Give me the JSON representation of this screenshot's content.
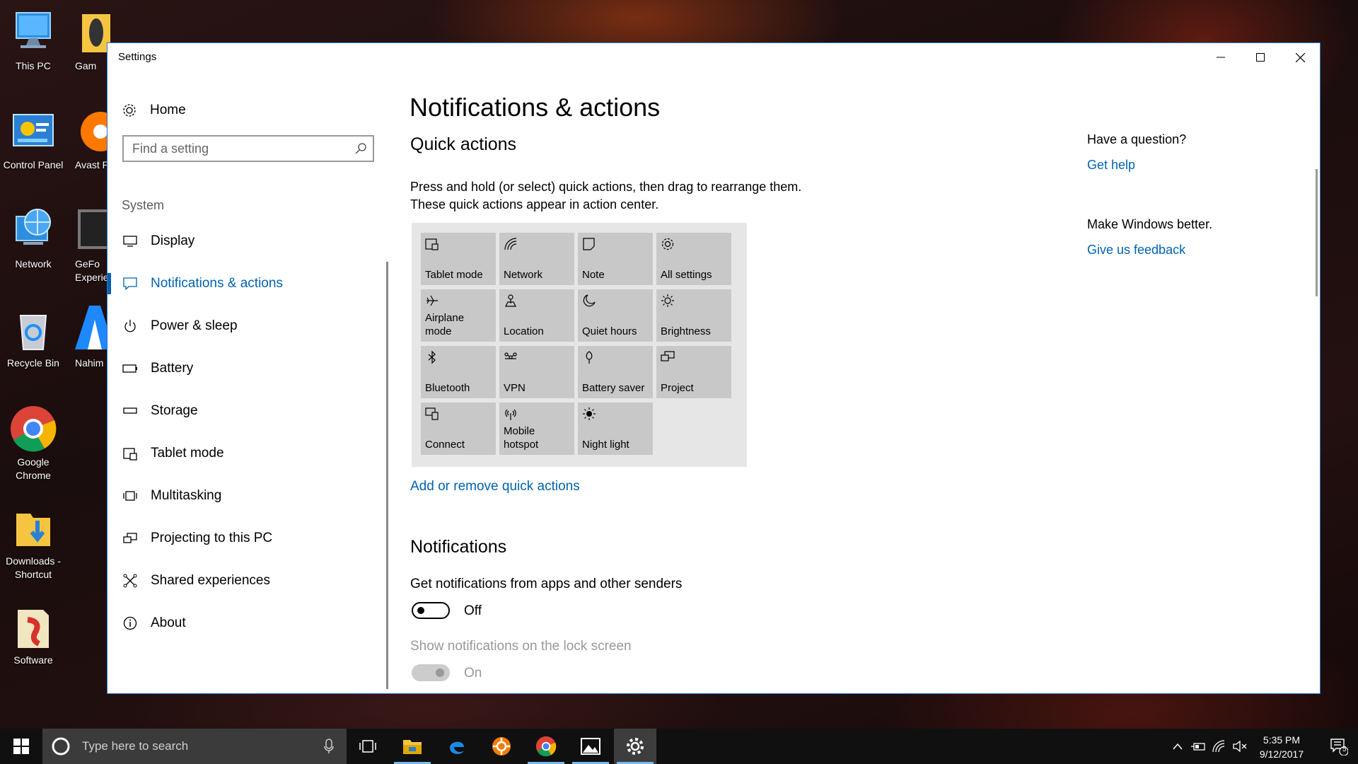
{
  "desktop": {
    "icons": [
      {
        "label": "This PC"
      },
      {
        "label": "Control Panel"
      },
      {
        "label": "Network"
      },
      {
        "label": "Recycle Bin"
      },
      {
        "label": "Google Chrome"
      },
      {
        "label": "Downloads - Shortcut"
      },
      {
        "label": "Software"
      }
    ],
    "icons_col2": [
      {
        "label": "Gam"
      },
      {
        "label": "Avast Pr"
      },
      {
        "label": "GeFo Experie"
      },
      {
        "label": "Nahim"
      }
    ]
  },
  "window": {
    "title": "Settings",
    "minimize_label": "—",
    "maximize_label": "☐",
    "close_label": "✕"
  },
  "nav": {
    "home_label": "Home",
    "search_placeholder": "Find a setting",
    "section_label": "System",
    "items": [
      {
        "label": "Display",
        "icon": "display-icon"
      },
      {
        "label": "Notifications & actions",
        "icon": "notification-icon",
        "active": true
      },
      {
        "label": "Power & sleep",
        "icon": "power-icon"
      },
      {
        "label": "Battery",
        "icon": "battery-icon"
      },
      {
        "label": "Storage",
        "icon": "storage-icon"
      },
      {
        "label": "Tablet mode",
        "icon": "tablet-mode-icon"
      },
      {
        "label": "Multitasking",
        "icon": "multitasking-icon"
      },
      {
        "label": "Projecting to this PC",
        "icon": "projecting-icon"
      },
      {
        "label": "Shared experiences",
        "icon": "shared-experiences-icon"
      },
      {
        "label": "About",
        "icon": "info-icon"
      }
    ]
  },
  "main": {
    "title": "Notifications & actions",
    "quick_actions": {
      "heading": "Quick actions",
      "description": "Press and hold (or select) quick actions, then drag to rearrange them. These quick actions appear in action center.",
      "tiles": [
        {
          "label": "Tablet mode",
          "icon": "tablet-mode-icon"
        },
        {
          "label": "Network",
          "icon": "network-icon"
        },
        {
          "label": "Note",
          "icon": "note-icon"
        },
        {
          "label": "All settings",
          "icon": "gear-icon"
        },
        {
          "label": "Airplane mode",
          "icon": "airplane-icon"
        },
        {
          "label": "Location",
          "icon": "location-icon"
        },
        {
          "label": "Quiet hours",
          "icon": "moon-icon"
        },
        {
          "label": "Brightness",
          "icon": "brightness-icon"
        },
        {
          "label": "Bluetooth",
          "icon": "bluetooth-icon"
        },
        {
          "label": "VPN",
          "icon": "vpn-icon"
        },
        {
          "label": "Battery saver",
          "icon": "battery-saver-icon"
        },
        {
          "label": "Project",
          "icon": "project-icon"
        },
        {
          "label": "Connect",
          "icon": "connect-icon"
        },
        {
          "label": "Mobile hotspot",
          "icon": "hotspot-icon"
        },
        {
          "label": "Night light",
          "icon": "night-light-icon"
        }
      ],
      "link": "Add or remove quick actions"
    },
    "notifications": {
      "heading": "Notifications",
      "get_notifications_label": "Get notifications from apps and other senders",
      "get_notifications_state": "Off",
      "lock_screen_label": "Show notifications on the lock screen",
      "lock_screen_state": "On"
    },
    "side": {
      "question": "Have a question?",
      "get_help": "Get help",
      "feedback_heading": "Make Windows better.",
      "feedback_link": "Give us feedback"
    }
  },
  "taskbar": {
    "search_placeholder": "Type here to search",
    "apps": [
      "task-view-icon",
      "file-explorer-icon",
      "edge-icon",
      "app-orange-icon",
      "chrome-icon",
      "photos-icon",
      "settings-icon"
    ],
    "time": "5:35 PM",
    "date": "9/12/2017",
    "notification_count": "5"
  }
}
